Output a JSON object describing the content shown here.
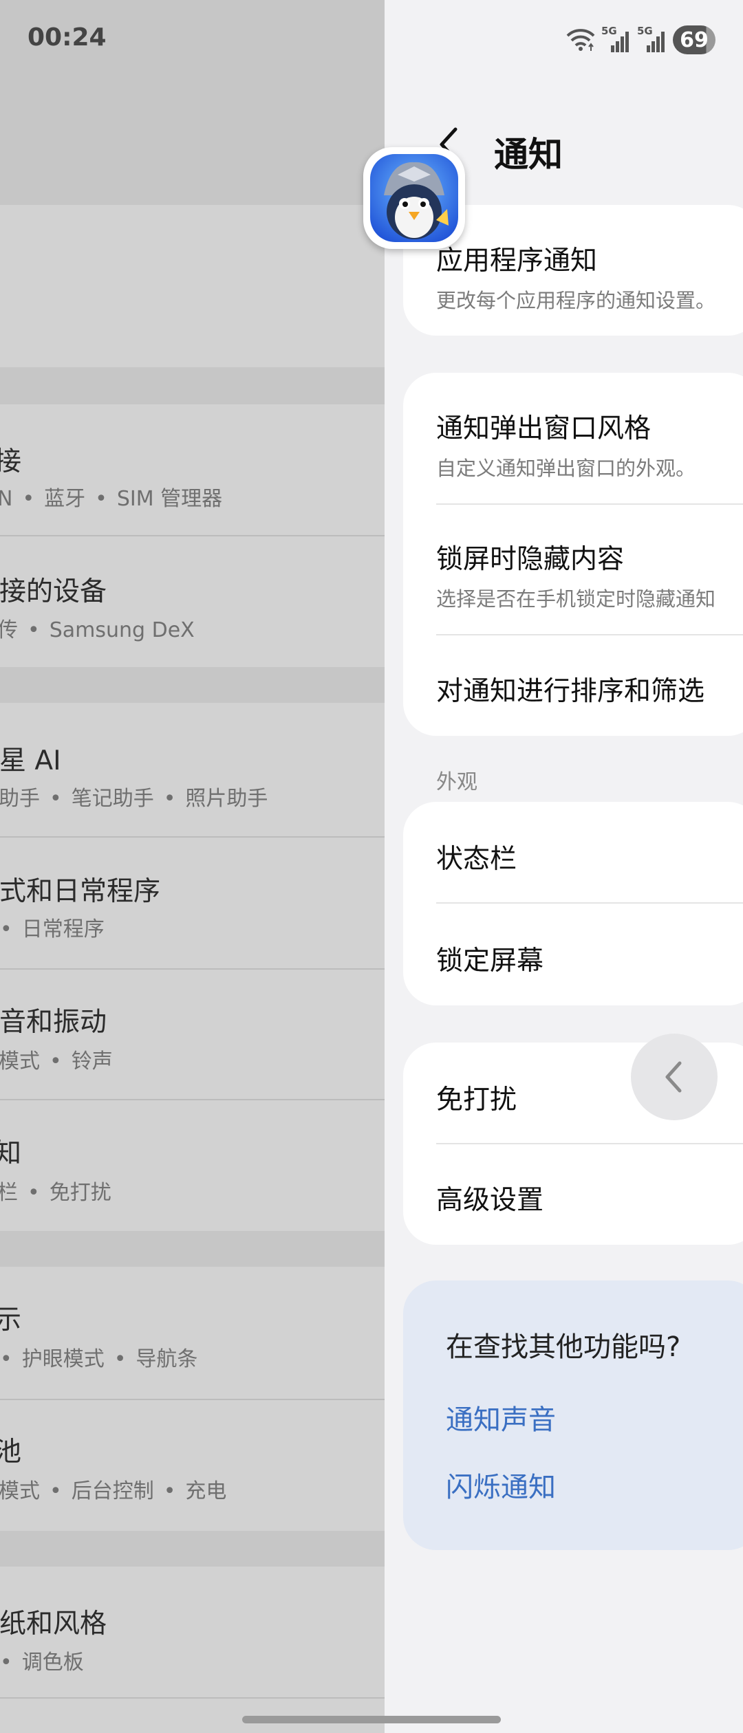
{
  "status_bar": {
    "time": "00:24",
    "battery": "69",
    "signal_labels": [
      "5G",
      "5G"
    ]
  },
  "left_panel": {
    "items": [
      {
        "title": "接",
        "subs": [
          "N",
          "蓝牙",
          "SIM 管理器"
        ]
      },
      {
        "title": "连接的设备",
        "subs": [
          "传",
          "Samsung DeX"
        ]
      },
      {
        "title": "三星 AI",
        "subs": [
          "助手",
          "笔记助手",
          "照片助手"
        ]
      },
      {
        "title": "模式和日常程序",
        "subs": [
          "",
          "日常程序"
        ]
      },
      {
        "title": "声音和振动",
        "subs": [
          "模式",
          "铃声"
        ]
      },
      {
        "title": "知",
        "subs": [
          "栏",
          "免打扰"
        ]
      },
      {
        "title": "示",
        "subs": [
          "",
          "护眼模式",
          "导航条"
        ]
      },
      {
        "title": "池",
        "subs": [
          "模式",
          "后台控制",
          "充电"
        ]
      },
      {
        "title": "壁纸和风格",
        "subs": [
          "",
          "调色板"
        ]
      }
    ]
  },
  "notifications": {
    "title": "通知",
    "app_notifications": {
      "title": "应用程序通知",
      "subtitle": "更改每个应用程序的通知设置。"
    },
    "popup_style": {
      "title": "通知弹出窗口风格",
      "subtitle": "自定义通知弹出窗口的外观。"
    },
    "hide_content": {
      "title": "锁屏时隐藏内容",
      "subtitle": "选择是否在手机锁定时隐藏通知"
    },
    "sort_filter": {
      "title": "对通知进行排序和筛选"
    },
    "appearance_label": "外观",
    "status_bar_item": "状态栏",
    "lock_screen_item": "锁定屏幕",
    "dnd_item": "免打扰",
    "advanced_item": "高级设置",
    "help": {
      "title": "在查找其他功能吗?",
      "link1": "通知声音",
      "link2": "闪烁通知"
    }
  }
}
